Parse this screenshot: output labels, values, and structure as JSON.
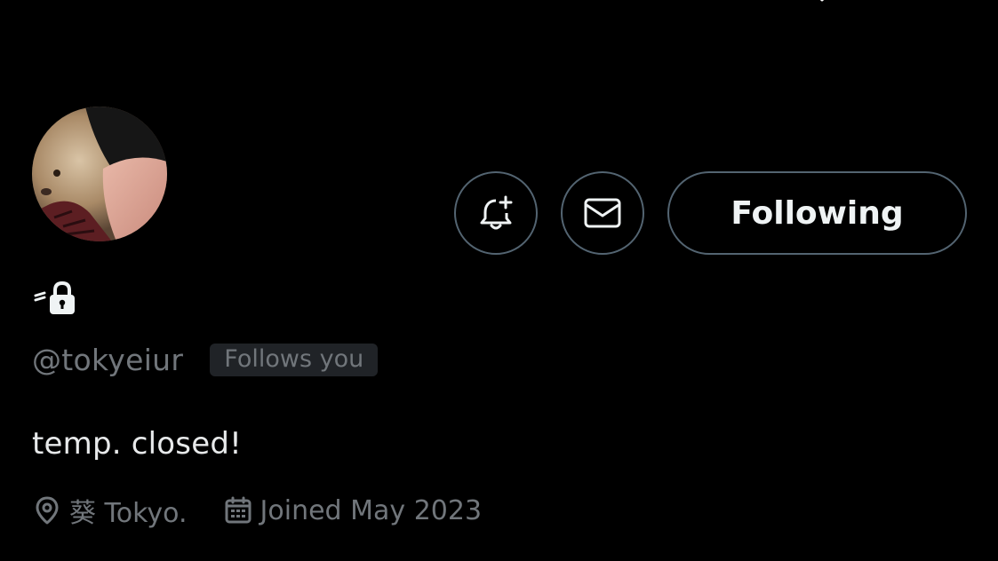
{
  "profile": {
    "handle": "@tokyeiur",
    "follows_you_badge": "Follows you",
    "bio": "temp. closed!",
    "location": "葵 Tokyo.",
    "joined": "Joined May 2023"
  },
  "actions": {
    "following_label": "Following"
  },
  "icons": {
    "notify": "bell-plus-icon",
    "message": "envelope-icon",
    "protected": "lock-icon",
    "location": "location-pin-icon",
    "calendar": "calendar-icon"
  },
  "colors": {
    "background": "#000000",
    "text_primary": "#e7e9ea",
    "text_secondary": "#71767b",
    "border": "#536471",
    "badge_bg": "#202327"
  }
}
